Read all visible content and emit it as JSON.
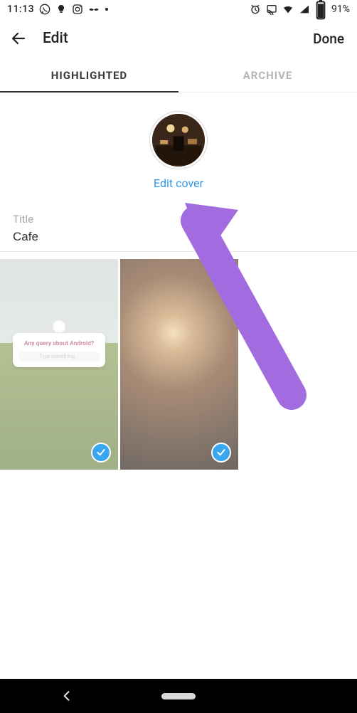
{
  "statusbar": {
    "time": "11:13",
    "battery_text": "91%"
  },
  "header": {
    "title": "Edit",
    "done_label": "Done"
  },
  "tabs": {
    "highlighted": "HIGHLIGHTED",
    "archive": "ARCHIVE"
  },
  "cover": {
    "edit_label": "Edit cover"
  },
  "title_field": {
    "label": "Title",
    "value": "Cafe"
  },
  "thumb1": {
    "question": "Any query about Android?",
    "placeholder": "Type something..."
  }
}
